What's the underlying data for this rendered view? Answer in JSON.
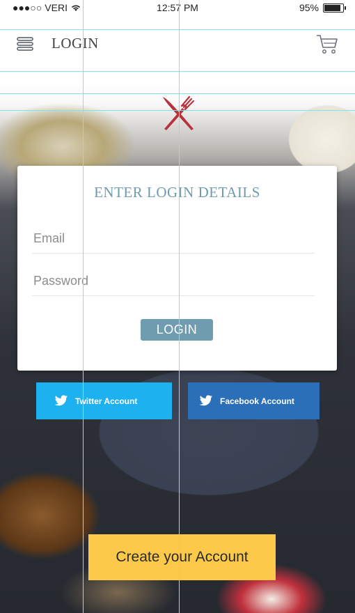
{
  "status_bar": {
    "signal": "●●●○○",
    "carrier": "VERI",
    "time": "12:57 PM",
    "battery_text": "95%",
    "battery_level": 0.95
  },
  "nav": {
    "menu_icon": "hamburger-icon",
    "title": "LOGIN",
    "cart_icon": "shopping-cart-icon"
  },
  "logo": {
    "icon": "fork-knife-icon",
    "color": "#b8323c"
  },
  "login_form": {
    "heading": "ENTER LOGIN DETAILS",
    "email_placeholder": "Email",
    "password_placeholder": "Password",
    "submit_label": "LOGIN"
  },
  "social": {
    "twitter_label": "Twitter Account",
    "facebook_label": "Facebook Account",
    "twitter_color": "#1eb1ef",
    "facebook_color": "#2b6fb8"
  },
  "create_account": {
    "label": "Create your Account",
    "color": "#fdc94b"
  }
}
